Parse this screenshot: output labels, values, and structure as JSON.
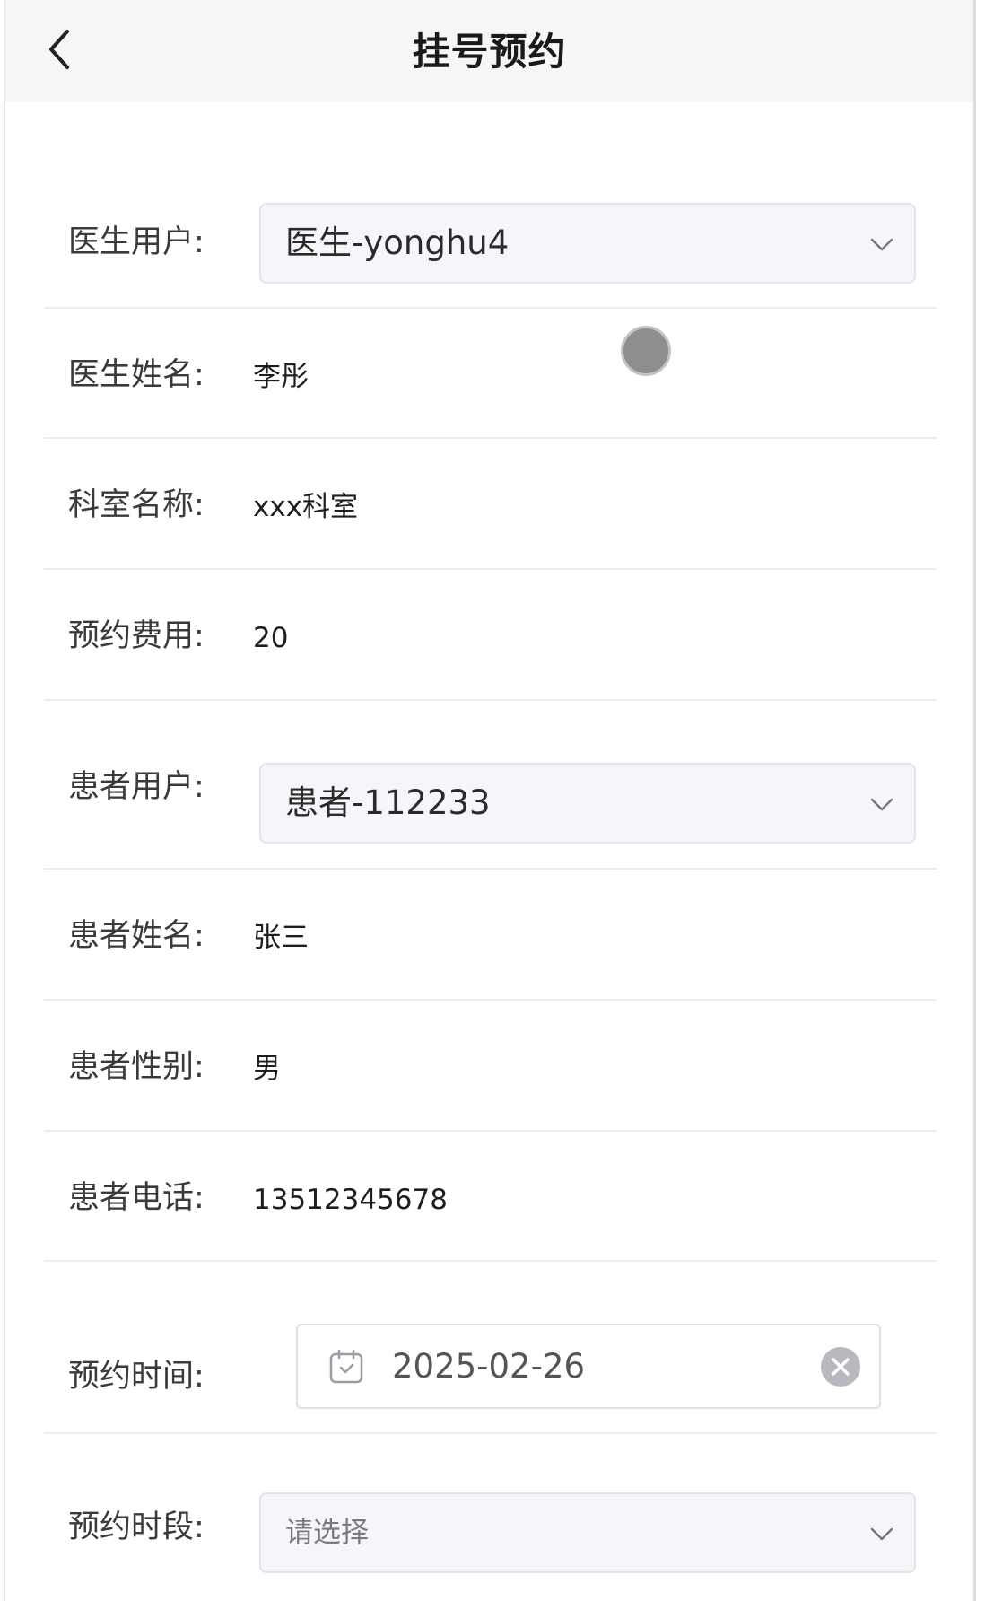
{
  "header": {
    "title": "挂号预约",
    "back_icon": "chevron-left-icon"
  },
  "form": {
    "doctor_user": {
      "label": "医生用户:",
      "value": "医生-yonghu4"
    },
    "doctor_name": {
      "label": "医生姓名:",
      "value": "李彤"
    },
    "department": {
      "label": "科室名称:",
      "value": "xxx科室"
    },
    "fee": {
      "label": "预约费用:",
      "value": "20"
    },
    "patient_user": {
      "label": "患者用户:",
      "value": "患者-112233"
    },
    "patient_name": {
      "label": "患者姓名:",
      "value": "张三"
    },
    "patient_gender": {
      "label": "患者性别:",
      "value": "男"
    },
    "patient_phone": {
      "label": "患者电话:",
      "value": "13512345678"
    },
    "appointment_date": {
      "label": "预约时间:",
      "value": "2025-02-26"
    },
    "time_slot": {
      "label": "预约时段:",
      "placeholder": "请选择"
    }
  }
}
